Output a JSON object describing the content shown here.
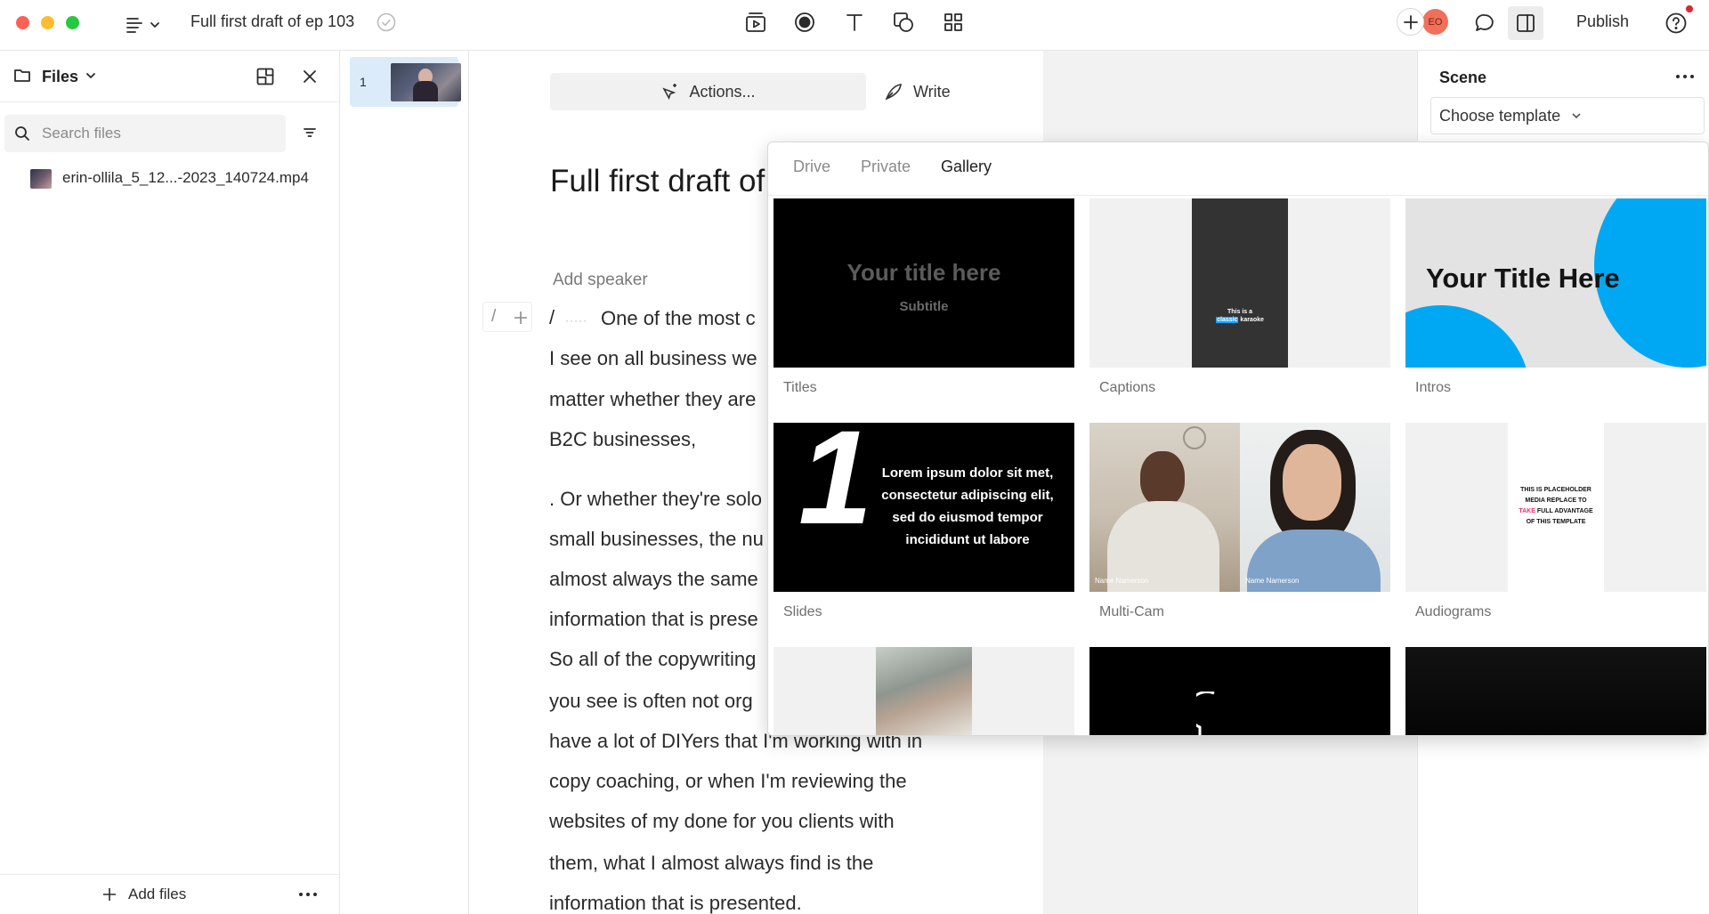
{
  "topbar": {
    "doc_title": "Full first draft of ep 103",
    "avatar_initials": "EO",
    "publish_label": "Publish",
    "accent_avatar": "#f0705a"
  },
  "files": {
    "title": "Files",
    "search_placeholder": "Search files",
    "items": [
      {
        "name": "erin-ollila_5_12...-2023_140724.mp4"
      }
    ],
    "add_files_label": "Add files"
  },
  "scenes": {
    "items": [
      {
        "number": "1"
      }
    ]
  },
  "editor": {
    "actions_label": "Actions...",
    "write_label": "Write",
    "title": "Full first draft of",
    "add_speaker": "Add speaker",
    "lines": [
      "One of the most c",
      "I see on all business we",
      "matter whether they are",
      "B2C businesses,",
      ". Or whether they're solo",
      "small businesses, the nu",
      "almost always the same",
      "information that is prese",
      "So all of the copywriting",
      "you see is often not org",
      "have a lot of DIYers that I'm working with in",
      "copy coaching, or when I'm reviewing the",
      "websites of my done for you clients with",
      "them, what I almost always find is the",
      "information that is presented."
    ]
  },
  "scene_panel": {
    "title": "Scene",
    "template_select": "Choose template"
  },
  "gallery": {
    "tabs": [
      "Drive",
      "Private",
      "Gallery"
    ],
    "active_tab": "Gallery",
    "cards": [
      {
        "label": "Titles",
        "title_text": "Your title here",
        "subtitle_text": "Subtitle"
      },
      {
        "label": "Captions",
        "caption_line1": "This is a",
        "caption_highlight": "classic",
        "caption_rest": "karaoke"
      },
      {
        "label": "Intros",
        "title_text": "Your Title Here",
        "accent": "#00a8f3"
      },
      {
        "label": "Slides",
        "big_number": "1",
        "body_text": "Lorem ipsum dolor sit met, consectetur adipiscing elit, sed do eiusmod tempor incididunt ut labore"
      },
      {
        "label": "Multi-Cam",
        "name_left": "Name Namerson",
        "name_right": "Name Namerson"
      },
      {
        "label": "Audiograms",
        "text_pre": "THIS IS PLACEHOLDER MEDIA REPLACE TO",
        "text_highlight": "TAKE",
        "text_post": "FULL ADVANTAGE OF THIS TEMPLATE",
        "highlight_color": "#e8336d"
      }
    ]
  }
}
